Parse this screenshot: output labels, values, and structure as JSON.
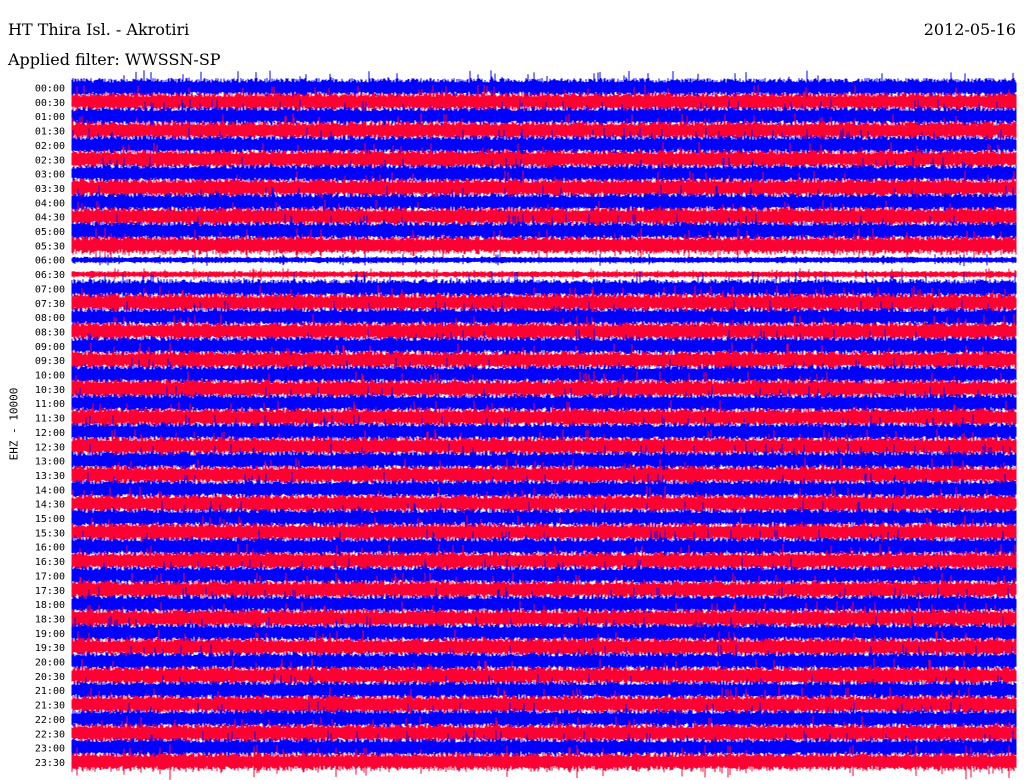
{
  "header": {
    "station": "HT Thira Isl. - Akrotiri",
    "filter": "Applied filter: WWSSN-SP",
    "date": "2012-05-16"
  },
  "colors": {
    "trace_a": "#0000ff",
    "trace_b": "#ff0033",
    "background": "#ffffff",
    "text": "#000000"
  },
  "chart_data": {
    "type": "line",
    "title": "HT Thira Isl. - Akrotiri",
    "ylabel": "EHZ - 10000",
    "rows": [
      "00:00",
      "00:30",
      "01:00",
      "01:30",
      "02:00",
      "02:30",
      "03:00",
      "03:30",
      "04:00",
      "04:30",
      "05:00",
      "05:30",
      "06:00",
      "06:30",
      "07:00",
      "07:30",
      "08:00",
      "08:30",
      "09:00",
      "09:30",
      "10:00",
      "10:30",
      "11:00",
      "11:30",
      "12:00",
      "12:30",
      "13:00",
      "13:30",
      "14:00",
      "14:30",
      "15:00",
      "15:30",
      "16:00",
      "16:30",
      "17:00",
      "17:30",
      "18:00",
      "18:30",
      "19:00",
      "19:30",
      "20:00",
      "20:30",
      "21:00",
      "21:30",
      "22:00",
      "22:30",
      "23:00",
      "23:30"
    ],
    "row_span_minutes": 30,
    "series": [
      {
        "name": "",
        "color": "#0000ff"
      },
      {
        "name": "",
        "color": "#ff0033"
      }
    ],
    "grid": false
  }
}
